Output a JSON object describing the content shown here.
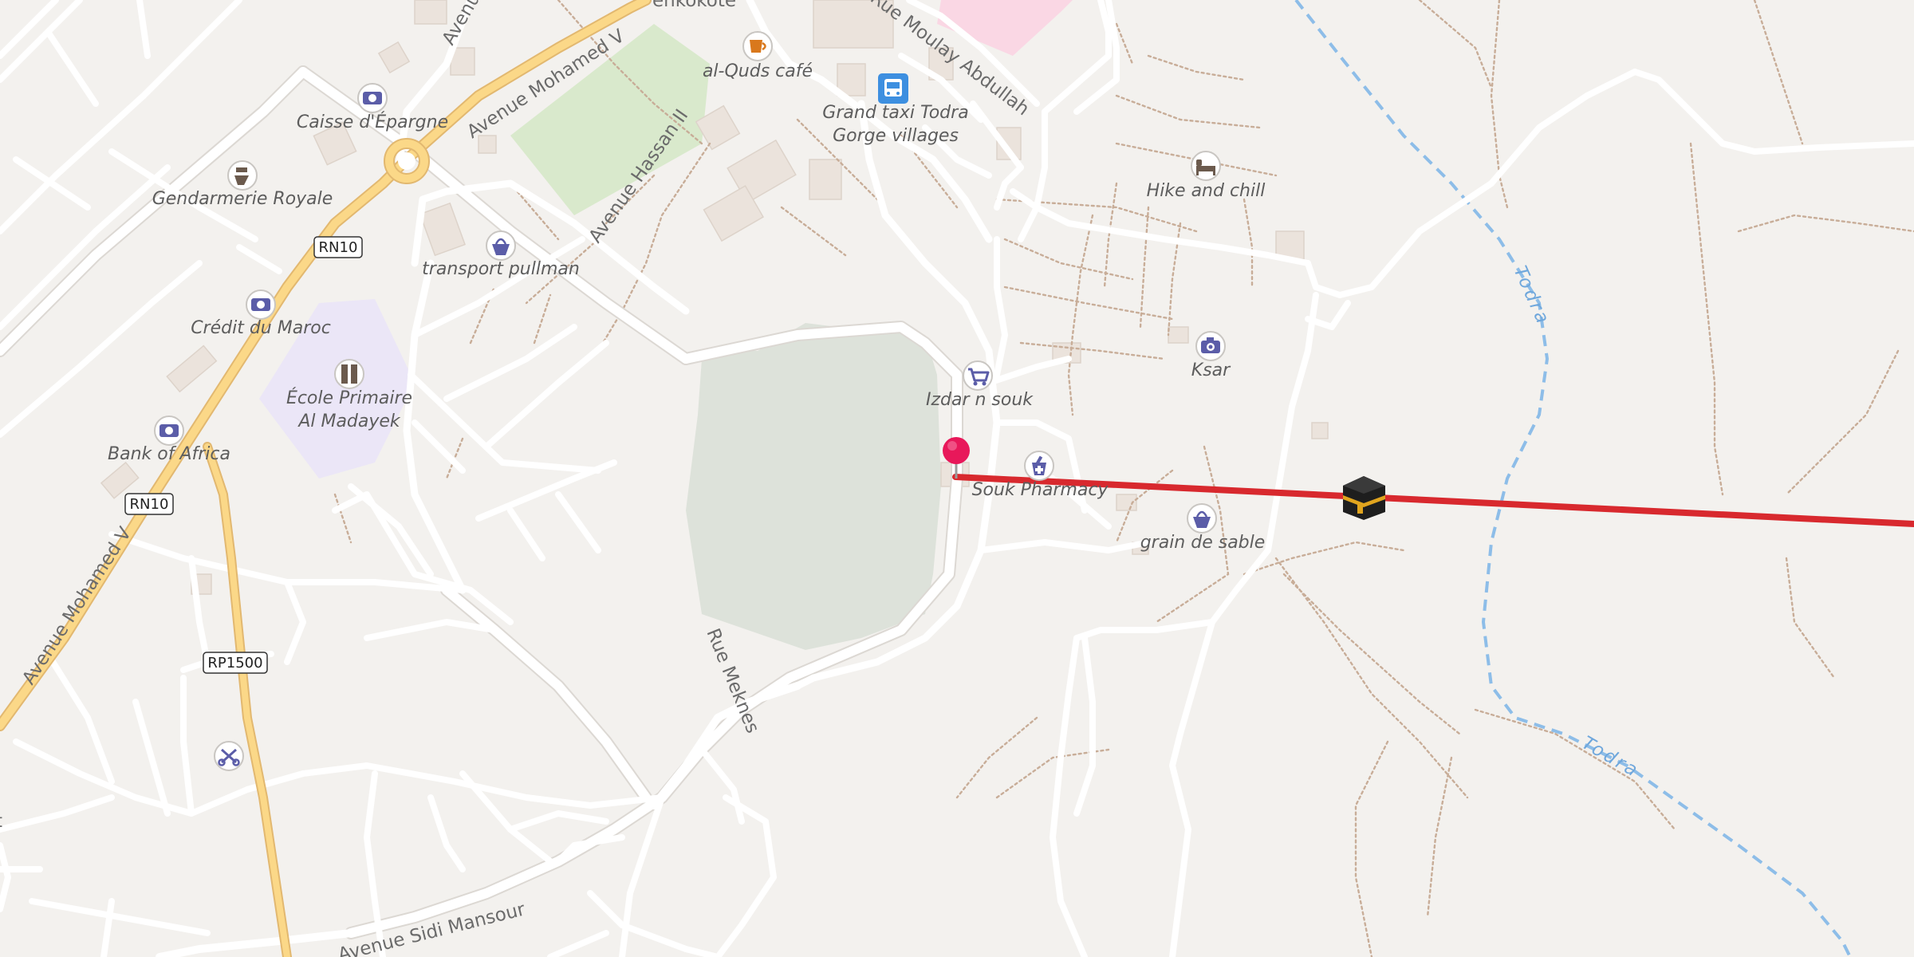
{
  "map": {
    "pois": [
      {
        "id": "caisse",
        "label": "Caisse d'Épargne",
        "icon": "bank-icon"
      },
      {
        "id": "gendarmerie",
        "label": "Gendarmerie Royale",
        "icon": "police-icon"
      },
      {
        "id": "credit",
        "label": "Crédit du Maroc",
        "icon": "bank-icon"
      },
      {
        "id": "bank_africa",
        "label": "Bank of Africa",
        "icon": "bank-icon"
      },
      {
        "id": "ecole",
        "label_line1": "École Primaire",
        "label_line2": "Al Madayek",
        "icon": "school-icon"
      },
      {
        "id": "transport",
        "label": "transport pullman",
        "icon": "shop-basket-icon"
      },
      {
        "id": "alquds",
        "label": "al-Quds café",
        "icon": "cafe-icon"
      },
      {
        "id": "grandtaxi",
        "label_line1": "Grand taxi Todra",
        "label_line2": "Gorge villages",
        "icon": "bus-stop-icon"
      },
      {
        "id": "hike",
        "label": "Hike and chill",
        "icon": "hostel-bed-icon"
      },
      {
        "id": "ksar",
        "label": "Ksar",
        "icon": "camera-icon"
      },
      {
        "id": "izdar",
        "label": "Izdar n souk",
        "icon": "shopping-cart-icon"
      },
      {
        "id": "pharmacy",
        "label": "Souk Pharmacy",
        "icon": "pharmacy-icon"
      },
      {
        "id": "grain",
        "label": "grain de sable",
        "icon": "shop-basket-icon"
      },
      {
        "id": "hairdresser",
        "icon": "scissors-icon"
      }
    ],
    "streets": {
      "mohamed_v_upper": "Avenue Mohamed V",
      "mohamed_v_lower": "Avenue Mohamed V",
      "hassan_ii": "Avenue Hassan II",
      "moulay": "Rue Moulay Abdullah",
      "meknes": "Rue Meknes",
      "sidi_mansour": "Avenue Sidi Mansour",
      "avenue_top": "Avenue",
      "partial_top": "enkokote",
      "partial_left": "t"
    },
    "shields": {
      "rn10_upper": "RN10",
      "rn10_lower": "RN10",
      "rp1500": "RP1500"
    },
    "river": {
      "label_1": "Todra",
      "label_2": "Todra"
    },
    "markers": {
      "pin": "location-pin",
      "destination": "kaaba-qibla-icon"
    },
    "colors": {
      "qibla_line": "#d8292e",
      "pin": "#e8185a",
      "poi_icon": "#5b5da8",
      "river": "#8dbde8",
      "trunk_road": "#fbd888"
    }
  }
}
